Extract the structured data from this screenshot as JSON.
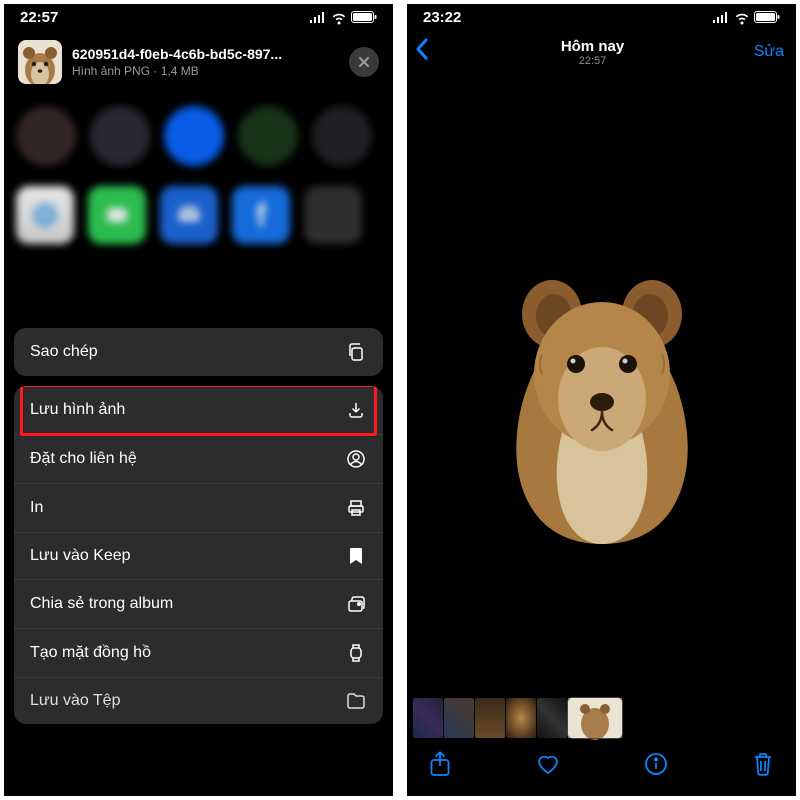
{
  "left": {
    "status_time": "22:57",
    "file_name": "620951d4-f0eb-4c6b-bd5c-897...",
    "file_meta": "Hình ảnh PNG · 1,4 MB",
    "actions": {
      "copy": "Sao chép",
      "save_image": "Lưu hình ảnh",
      "assign_contact": "Đặt cho liên hệ",
      "print": "In",
      "save_keep": "Lưu vào Keep",
      "share_album": "Chia sẻ trong album",
      "watch_face": "Tạo mặt đồng hồ",
      "save_files": "Lưu vào Tệp"
    }
  },
  "right": {
    "status_time": "23:22",
    "title": "Hôm nay",
    "subtitle": "22:57",
    "edit": "Sửa"
  }
}
